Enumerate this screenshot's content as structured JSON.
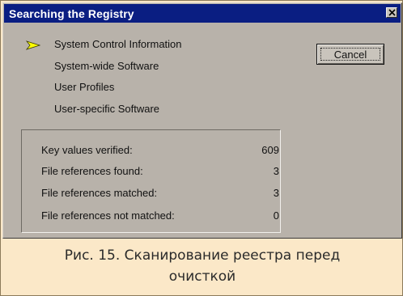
{
  "window": {
    "title": "Searching the Registry",
    "close_symbol": "✕"
  },
  "steps": {
    "items": [
      {
        "label": "System Control Information",
        "active": true
      },
      {
        "label": "System-wide Software",
        "active": false
      },
      {
        "label": "User Profiles",
        "active": false
      },
      {
        "label": "User-specific Software",
        "active": false
      }
    ]
  },
  "buttons": {
    "cancel_label": "Cancel"
  },
  "stats": {
    "rows": [
      {
        "label": "Key values verified:",
        "value": "609"
      },
      {
        "label": "File references found:",
        "value": "3"
      },
      {
        "label": "File references matched:",
        "value": "3"
      },
      {
        "label": "File references not matched:",
        "value": "0"
      }
    ]
  },
  "caption": {
    "line1": "Рис. 15. Сканирование реестра перед",
    "line2": "очисткой"
  },
  "colors": {
    "titlebar": "#0a1e82",
    "dialog_face": "#b8b2aa",
    "arrow": "#ffff00",
    "page_background": "#fbe8c8"
  }
}
